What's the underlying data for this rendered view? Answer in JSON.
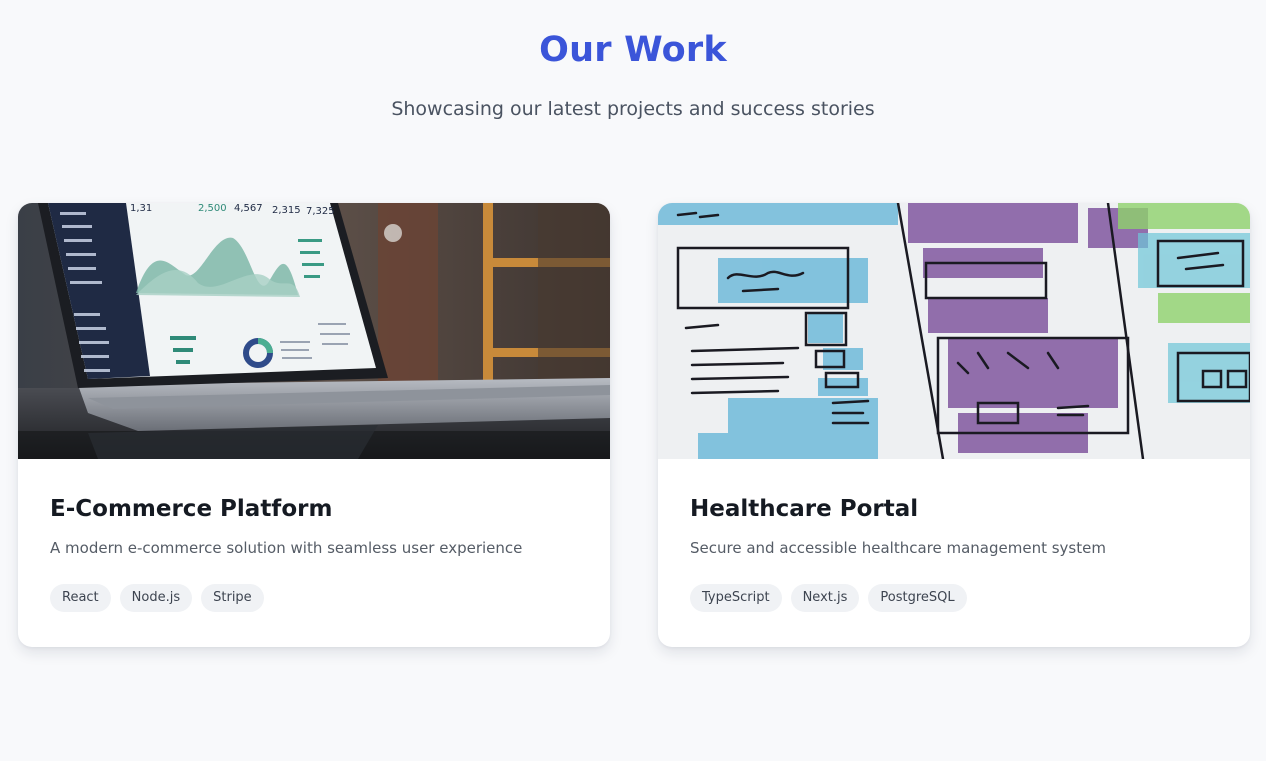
{
  "section": {
    "title": "Our Work",
    "subtitle": "Showcasing our latest projects and success stories"
  },
  "colors": {
    "accent": "#3b55d9",
    "background": "#f8f9fb",
    "card": "#ffffff",
    "tag_bg": "#f0f2f5"
  },
  "projects": [
    {
      "title": "E-Commerce Platform",
      "description": "A modern e-commerce solution with seamless user experience",
      "image": "laptop-analytics-dashboard-photo",
      "image_text": {
        "stats": [
          "1,31",
          "2,500",
          "4,567",
          "2,315",
          "7,325"
        ]
      },
      "tags": [
        "React",
        "Node.js",
        "Stripe"
      ]
    },
    {
      "title": "Healthcare Portal",
      "description": "Secure and accessible healthcare management system",
      "image": "watercolor-wireframe-sketch-photo",
      "tags": [
        "TypeScript",
        "Next.js",
        "PostgreSQL"
      ]
    }
  ]
}
